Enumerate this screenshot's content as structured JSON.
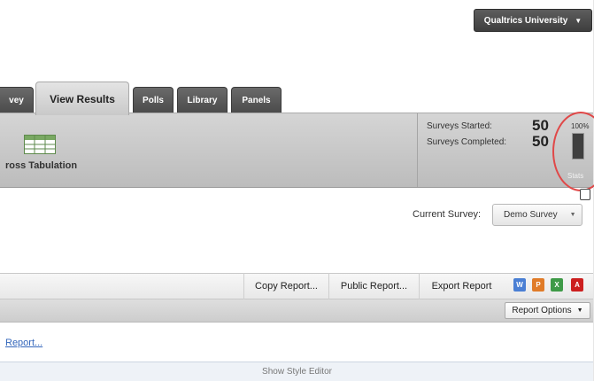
{
  "header": {
    "account_menu_label": "Qualtrics University",
    "account_menu_caret": "▼"
  },
  "tabs": [
    {
      "label": "vey",
      "active": false
    },
    {
      "label": "View Results",
      "active": true
    },
    {
      "label": "Polls",
      "active": false
    },
    {
      "label": "Library",
      "active": false
    },
    {
      "label": "Panels",
      "active": false
    }
  ],
  "ribbon": {
    "cross_tab_label": "ross Tabulation",
    "cross_tab_icon": "table-icon",
    "stats": {
      "started_label": "Surveys Started:",
      "started_value": "50",
      "completed_label": "Surveys Completed:",
      "completed_value": "50",
      "percent_label": "100%",
      "completion_fraction": 1.0,
      "stats_label": "Stats"
    },
    "highlight_color": "#e04848"
  },
  "survey_selector": {
    "label": "Current Survey:",
    "selected": "Demo Survey",
    "caret": "▼"
  },
  "report_toolbar": {
    "copy_label": "Copy Report...",
    "public_label": "Public Report...",
    "export_label": "Export Report",
    "export_icons": [
      {
        "name": "word-export-icon",
        "color": "#4a7fd4",
        "glyph": "W"
      },
      {
        "name": "powerpoint-export-icon",
        "color": "#e07b28",
        "glyph": "P"
      },
      {
        "name": "excel-export-icon",
        "color": "#3e9a47",
        "glyph": "X"
      },
      {
        "name": "pdf-export-icon",
        "color": "#cc1f1f",
        "glyph": "A"
      }
    ],
    "options_label": "Report Options",
    "options_caret": "▼"
  },
  "report_link": "Report...",
  "style_editor_label": "Show Style Editor"
}
